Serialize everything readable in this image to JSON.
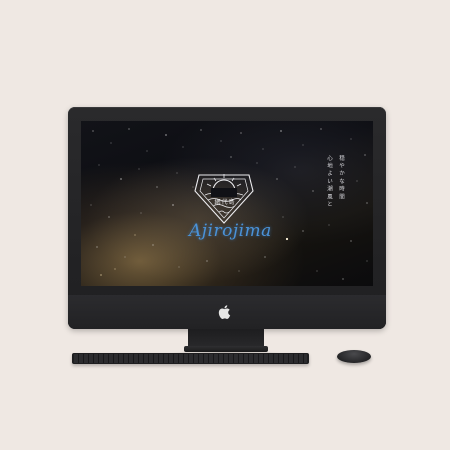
{
  "site": {
    "brand_name": "Ajirojima",
    "emblem_label": "網代島",
    "vertical_lines": [
      "心地よい潮風と",
      "穏やかな時間"
    ]
  },
  "icons": {
    "apple_logo": "apple-icon",
    "emblem": "shield-sun-emblem"
  },
  "colors": {
    "background": "#efe8e3",
    "monitor": "#232325",
    "brand_blue": "#4a92d8"
  }
}
